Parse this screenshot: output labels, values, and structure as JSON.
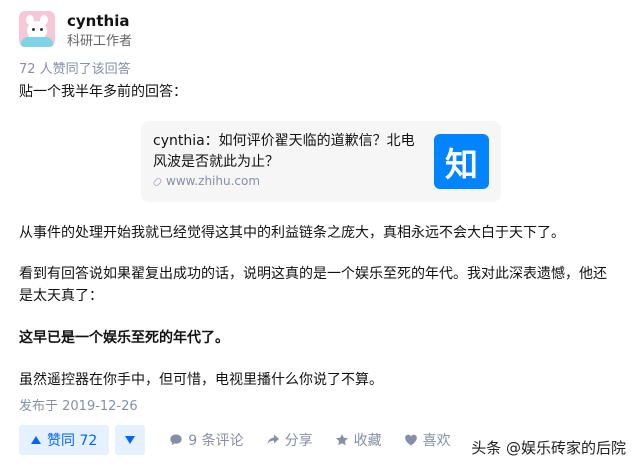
{
  "author": {
    "name": "cynthia",
    "title": "科研工作者"
  },
  "upvote_note": "72 人赞同了该回答",
  "intro": "贴一个我半年多前的回答：",
  "link_card": {
    "title": "cynthia：如何评价翟天临的道歉信？北电风波是否就此为止？",
    "url": "www.zhihu.com",
    "logo_char": "知"
  },
  "paragraphs": {
    "p1": "从事件的处理开始我就已经觉得这其中的利益链条之庞大，真相永远不会大白于天下了。",
    "p2": "看到有回答说如果翟复出成功的话，说明这真的是一个娱乐至死的年代。我对此深表遗憾，他还是太天真了：",
    "p3": "这早已是一个娱乐至死的年代了。",
    "p4": "虽然遥控器在你手中，但可惜，电视里播什么你说了不算。"
  },
  "published": "发布于 2019-12-26",
  "actions": {
    "upvote_label": "赞同 72",
    "comments_label": "9 条评论",
    "share_label": "分享",
    "favorite_label": "收藏",
    "like_label": "喜欢"
  },
  "watermark": "头条 @娱乐砖家的后院",
  "colors": {
    "accent": "#0066ff",
    "accent_bg": "#e5f1ff",
    "muted": "#8590a6",
    "logo_bg": "#0084ff"
  }
}
